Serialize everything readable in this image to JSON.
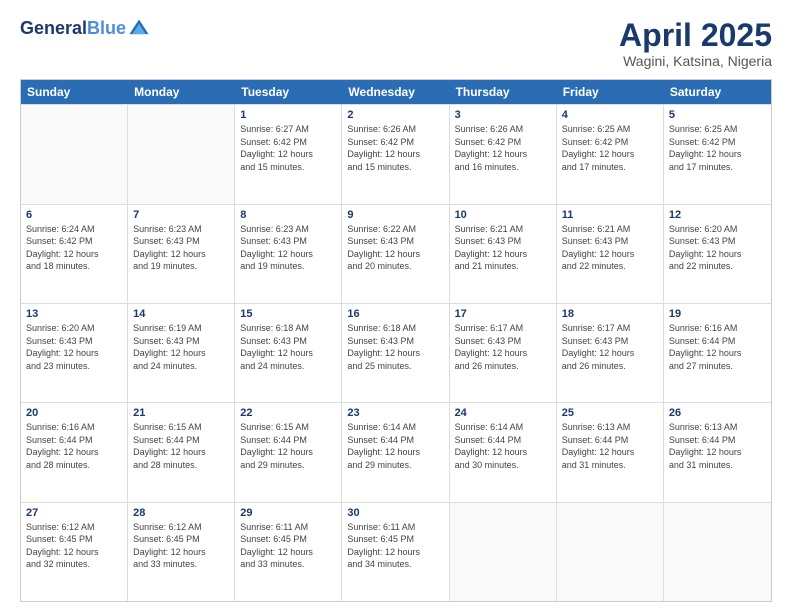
{
  "logo": {
    "line1": "General",
    "line2": "Blue"
  },
  "title": "April 2025",
  "subtitle": "Wagini, Katsina, Nigeria",
  "dayHeaders": [
    "Sunday",
    "Monday",
    "Tuesday",
    "Wednesday",
    "Thursday",
    "Friday",
    "Saturday"
  ],
  "weeks": [
    [
      {
        "day": "",
        "info": ""
      },
      {
        "day": "",
        "info": ""
      },
      {
        "day": "1",
        "info": "Sunrise: 6:27 AM\nSunset: 6:42 PM\nDaylight: 12 hours\nand 15 minutes."
      },
      {
        "day": "2",
        "info": "Sunrise: 6:26 AM\nSunset: 6:42 PM\nDaylight: 12 hours\nand 15 minutes."
      },
      {
        "day": "3",
        "info": "Sunrise: 6:26 AM\nSunset: 6:42 PM\nDaylight: 12 hours\nand 16 minutes."
      },
      {
        "day": "4",
        "info": "Sunrise: 6:25 AM\nSunset: 6:42 PM\nDaylight: 12 hours\nand 17 minutes."
      },
      {
        "day": "5",
        "info": "Sunrise: 6:25 AM\nSunset: 6:42 PM\nDaylight: 12 hours\nand 17 minutes."
      }
    ],
    [
      {
        "day": "6",
        "info": "Sunrise: 6:24 AM\nSunset: 6:42 PM\nDaylight: 12 hours\nand 18 minutes."
      },
      {
        "day": "7",
        "info": "Sunrise: 6:23 AM\nSunset: 6:43 PM\nDaylight: 12 hours\nand 19 minutes."
      },
      {
        "day": "8",
        "info": "Sunrise: 6:23 AM\nSunset: 6:43 PM\nDaylight: 12 hours\nand 19 minutes."
      },
      {
        "day": "9",
        "info": "Sunrise: 6:22 AM\nSunset: 6:43 PM\nDaylight: 12 hours\nand 20 minutes."
      },
      {
        "day": "10",
        "info": "Sunrise: 6:21 AM\nSunset: 6:43 PM\nDaylight: 12 hours\nand 21 minutes."
      },
      {
        "day": "11",
        "info": "Sunrise: 6:21 AM\nSunset: 6:43 PM\nDaylight: 12 hours\nand 22 minutes."
      },
      {
        "day": "12",
        "info": "Sunrise: 6:20 AM\nSunset: 6:43 PM\nDaylight: 12 hours\nand 22 minutes."
      }
    ],
    [
      {
        "day": "13",
        "info": "Sunrise: 6:20 AM\nSunset: 6:43 PM\nDaylight: 12 hours\nand 23 minutes."
      },
      {
        "day": "14",
        "info": "Sunrise: 6:19 AM\nSunset: 6:43 PM\nDaylight: 12 hours\nand 24 minutes."
      },
      {
        "day": "15",
        "info": "Sunrise: 6:18 AM\nSunset: 6:43 PM\nDaylight: 12 hours\nand 24 minutes."
      },
      {
        "day": "16",
        "info": "Sunrise: 6:18 AM\nSunset: 6:43 PM\nDaylight: 12 hours\nand 25 minutes."
      },
      {
        "day": "17",
        "info": "Sunrise: 6:17 AM\nSunset: 6:43 PM\nDaylight: 12 hours\nand 26 minutes."
      },
      {
        "day": "18",
        "info": "Sunrise: 6:17 AM\nSunset: 6:43 PM\nDaylight: 12 hours\nand 26 minutes."
      },
      {
        "day": "19",
        "info": "Sunrise: 6:16 AM\nSunset: 6:44 PM\nDaylight: 12 hours\nand 27 minutes."
      }
    ],
    [
      {
        "day": "20",
        "info": "Sunrise: 6:16 AM\nSunset: 6:44 PM\nDaylight: 12 hours\nand 28 minutes."
      },
      {
        "day": "21",
        "info": "Sunrise: 6:15 AM\nSunset: 6:44 PM\nDaylight: 12 hours\nand 28 minutes."
      },
      {
        "day": "22",
        "info": "Sunrise: 6:15 AM\nSunset: 6:44 PM\nDaylight: 12 hours\nand 29 minutes."
      },
      {
        "day": "23",
        "info": "Sunrise: 6:14 AM\nSunset: 6:44 PM\nDaylight: 12 hours\nand 29 minutes."
      },
      {
        "day": "24",
        "info": "Sunrise: 6:14 AM\nSunset: 6:44 PM\nDaylight: 12 hours\nand 30 minutes."
      },
      {
        "day": "25",
        "info": "Sunrise: 6:13 AM\nSunset: 6:44 PM\nDaylight: 12 hours\nand 31 minutes."
      },
      {
        "day": "26",
        "info": "Sunrise: 6:13 AM\nSunset: 6:44 PM\nDaylight: 12 hours\nand 31 minutes."
      }
    ],
    [
      {
        "day": "27",
        "info": "Sunrise: 6:12 AM\nSunset: 6:45 PM\nDaylight: 12 hours\nand 32 minutes."
      },
      {
        "day": "28",
        "info": "Sunrise: 6:12 AM\nSunset: 6:45 PM\nDaylight: 12 hours\nand 33 minutes."
      },
      {
        "day": "29",
        "info": "Sunrise: 6:11 AM\nSunset: 6:45 PM\nDaylight: 12 hours\nand 33 minutes."
      },
      {
        "day": "30",
        "info": "Sunrise: 6:11 AM\nSunset: 6:45 PM\nDaylight: 12 hours\nand 34 minutes."
      },
      {
        "day": "",
        "info": ""
      },
      {
        "day": "",
        "info": ""
      },
      {
        "day": "",
        "info": ""
      }
    ]
  ]
}
